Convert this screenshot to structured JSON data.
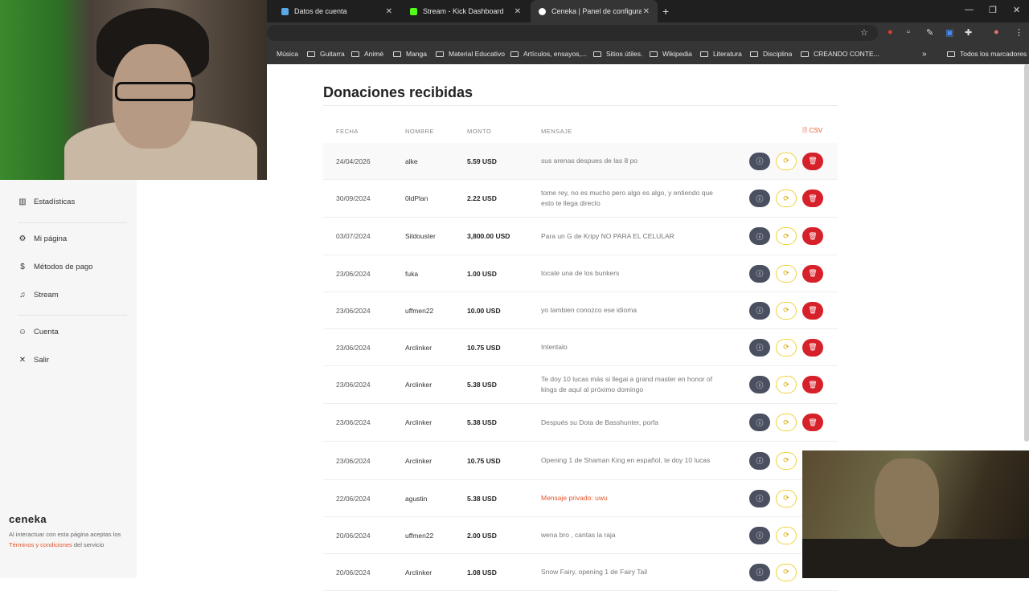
{
  "browser": {
    "tabs": [
      {
        "label": "Datos de cuenta",
        "favicon_color": "#5aa9e6"
      },
      {
        "label": "Stream - Kick Dashboard",
        "favicon_color": "#53fc18"
      },
      {
        "label": "Ceneka | Panel de configuración",
        "favicon_color": "#ffffff"
      }
    ],
    "new_tab": "+",
    "bookmarks": [
      "Música",
      "Guitarra",
      "Animé",
      "Manga",
      "Material Educativo",
      "Artículos, ensayos,...",
      "Sitios útiles.",
      "Wikipedia",
      "Literatura",
      "Disciplina",
      "CREANDO CONTE..."
    ],
    "bookmarks_more": "»",
    "all_bookmarks": "Todos los marcadores"
  },
  "sidebar": {
    "items": [
      {
        "label": "Estadísticas",
        "icon": "chart-icon",
        "glyph": "▥"
      },
      {
        "label": "Mi página",
        "icon": "gear-icon",
        "glyph": "⚙"
      },
      {
        "label": "Métodos de pago",
        "icon": "dollar-icon",
        "glyph": "$"
      },
      {
        "label": "Stream",
        "icon": "bell-icon",
        "glyph": "♫"
      },
      {
        "label": "Cuenta",
        "icon": "user-icon",
        "glyph": "☺"
      },
      {
        "label": "Salir",
        "icon": "close-icon",
        "glyph": "✕"
      }
    ],
    "brand": "ceneka",
    "legal_pre": "Al interactuar con esta página aceptas los ",
    "legal_link": "Términos y condiciones",
    "legal_post": " del servicio"
  },
  "main": {
    "title": "Donaciones recibidas",
    "columns": {
      "date": "FECHA",
      "name": "NOMBRE",
      "amount": "MONTO",
      "message": "MENSAJE"
    },
    "csv_label": "CSV",
    "rows": [
      {
        "date": "24/04/2026",
        "name": "alke",
        "amount": "5.59 USD",
        "message": "sus arenas despues de las 8 po",
        "private": false,
        "deletable": true
      },
      {
        "date": "30/09/2024",
        "name": "0ldPlan",
        "amount": "2.22 USD",
        "message": "tome rey, no es mucho pero algo es algo, y entiendo que esto te llega directo",
        "private": false,
        "deletable": true
      },
      {
        "date": "03/07/2024",
        "name": "Sildouster",
        "amount": "3,800.00 USD",
        "message": "Para un G de Kripy NO PARA EL CELULAR",
        "private": false,
        "deletable": true
      },
      {
        "date": "23/06/2024",
        "name": "fuka",
        "amount": "1.00 USD",
        "message": "tocate una de los bunkers",
        "private": false,
        "deletable": true
      },
      {
        "date": "23/06/2024",
        "name": "uffmen22",
        "amount": "10.00 USD",
        "message": "yo tambien conozco ese idioma",
        "private": false,
        "deletable": true
      },
      {
        "date": "23/06/2024",
        "name": "Arclinker",
        "amount": "10.75 USD",
        "message": "Intentalo",
        "private": false,
        "deletable": true
      },
      {
        "date": "23/06/2024",
        "name": "Arclinker",
        "amount": "5.38 USD",
        "message": "Te doy 10 lucas más si llegai a grand master en honor of kings de aquí al próximo domingo",
        "private": false,
        "deletable": true
      },
      {
        "date": "23/06/2024",
        "name": "Arclinker",
        "amount": "5.38 USD",
        "message": "Después su Dota de Basshunter, porfa",
        "private": false,
        "deletable": true
      },
      {
        "date": "23/06/2024",
        "name": "Arclinker",
        "amount": "10.75 USD",
        "message": "Opening 1 de Shaman King en español, te doy 10 lucas",
        "private": false,
        "deletable": false
      },
      {
        "date": "22/06/2024",
        "name": "agustin",
        "amount": "5.38 USD",
        "message": "Mensaje privado: uwu",
        "private": true,
        "deletable": false
      },
      {
        "date": "20/06/2024",
        "name": "uffmen22",
        "amount": "2.00 USD",
        "message": "wena bro , cantas la raja",
        "private": false,
        "deletable": false
      },
      {
        "date": "20/06/2024",
        "name": "Arclinker",
        "amount": "1.08 USD",
        "message": "Snow Fairy, opening 1 de Fairy Tail",
        "private": false,
        "deletable": false
      }
    ]
  }
}
